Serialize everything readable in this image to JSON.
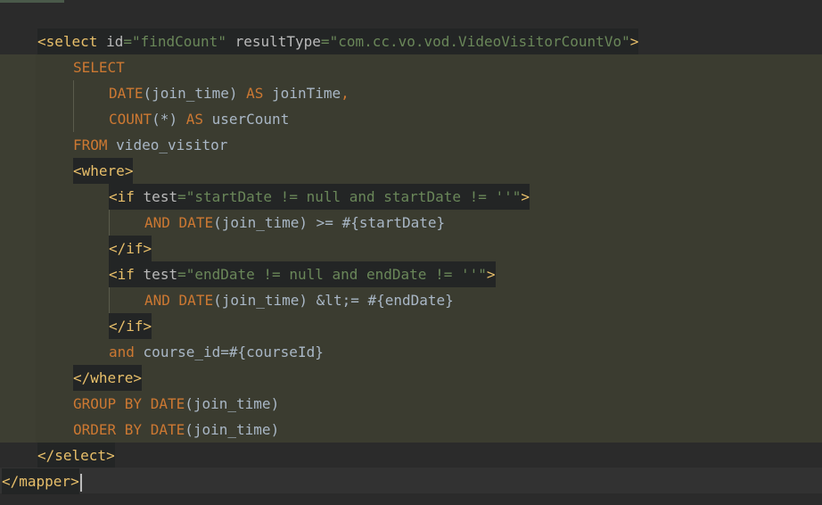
{
  "editor": {
    "select_open": {
      "lt": "<",
      "tag": "select",
      "attr1_name": "id",
      "eq": "=",
      "attr1_value": "\"findCount\"",
      "attr2_name": "resultType",
      "attr2_value": "\"com.cc.vo.vod.VideoVisitorCountVo\"",
      "gt": ">"
    },
    "sql": {
      "select_kw": "SELECT",
      "date_fn": "DATE",
      "date_args": "(join_time)",
      "as_kw": "AS",
      "alias1": "joinTime",
      "comma": ",",
      "count_fn": "COUNT",
      "count_args": "(*)",
      "alias2": "userCount",
      "from_kw": "FROM",
      "table": "video_visitor"
    },
    "where_open": {
      "lt": "<",
      "tag": "where",
      "gt": ">"
    },
    "if1": {
      "lt": "<",
      "tag": "if",
      "attr_name": "test",
      "eq": "=",
      "attr_value": "\"startDate != null and startDate != ''\"",
      "gt": ">",
      "and_kw": "AND",
      "date_fn": "DATE",
      "expr": "(join_time) >= #{startDate}",
      "close": "</if>"
    },
    "if2": {
      "lt": "<",
      "tag": "if",
      "attr_name": "test",
      "eq": "=",
      "attr_value": "\"endDate != null and endDate != ''\"",
      "gt": ">",
      "and_kw": "AND",
      "date_fn": "DATE",
      "expr": "(join_time) &lt;= #{endDate}",
      "close": "</if>"
    },
    "and_line": {
      "and_kw": "and",
      "expr": "course_id=#{courseId}"
    },
    "where_close": "</where>",
    "group_by": {
      "kw": "GROUP BY",
      "date_fn": "DATE",
      "args": "(join_time)"
    },
    "order_by": {
      "kw": "ORDER BY",
      "date_fn": "DATE",
      "args": "(join_time)"
    },
    "select_close": "</select>",
    "mapper_close": {
      "lt": "</",
      "tag": "mapper",
      "gt": ">"
    }
  },
  "colors": {
    "background": "#2b2b2b",
    "injected_sql_background": "#3b3c30",
    "keyword": "#cc7832",
    "tag": "#e8bf6a",
    "string": "#6a8759",
    "text": "#a9b7c6"
  }
}
